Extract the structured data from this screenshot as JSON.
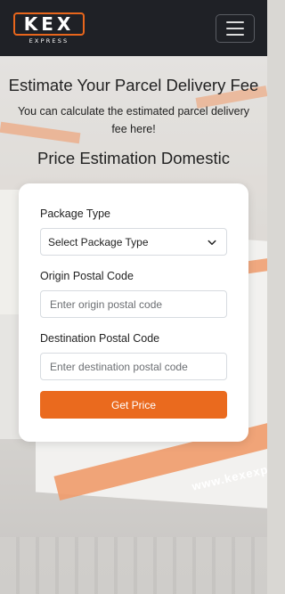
{
  "header": {
    "logo_text": "KEX",
    "logo_subtext": "EXPRESS",
    "menu_icon": "hamburger-menu-icon"
  },
  "hero": {
    "title": "Estimate Your Parcel Delivery Fee",
    "subtitle": "You can calculate the estimated parcel delivery fee here!",
    "section_title": "Price Estimation Domestic"
  },
  "form": {
    "package_type_label": "Package Type",
    "package_type_value": "Select Package Type",
    "origin_label": "Origin Postal Code",
    "origin_placeholder": "Enter origin postal code",
    "destination_label": "Destination Postal Code",
    "destination_placeholder": "Enter destination postal code",
    "submit_label": "Get Price"
  },
  "background": {
    "watermark_text": "www.kexexp"
  },
  "colors": {
    "brand_orange": "#ea6a1e",
    "navbar": "#1f2126"
  }
}
